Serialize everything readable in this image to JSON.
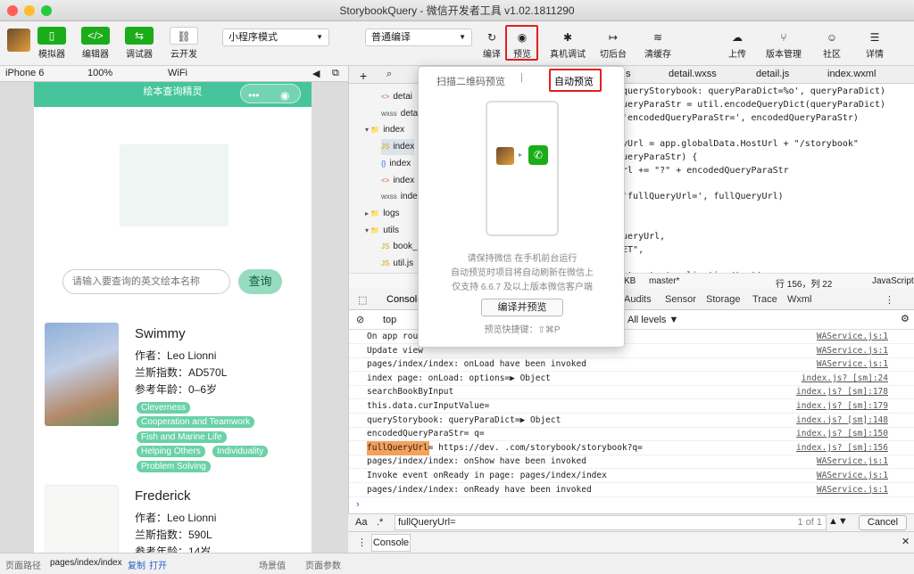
{
  "window": {
    "title": "StorybookQuery - 微信开发者工具 v1.02.1811290"
  },
  "colors": {
    "close": "#fe5f57",
    "minimize": "#febc2e",
    "maximize": "#28c840",
    "accent_green": "#1aad19",
    "nav_green": "#46c59c",
    "highlight_red": "#e0201e",
    "tag_green": "#6ad1a8"
  },
  "toolbar": {
    "simulator": "模拟器",
    "editor": "编辑器",
    "debugger": "调试器",
    "cloud": "云开发",
    "mode_select": "小程序模式",
    "compile_select": "普通编译",
    "compile": "编译",
    "preview": "预览",
    "remote_debug": "真机调试",
    "background": "切后台",
    "clear_cache": "清缓存",
    "upload": "上传",
    "version": "版本管理",
    "community": "社区",
    "details": "详情"
  },
  "device_bar": {
    "device": "iPhone 6",
    "zoom": "100%",
    "network": "WiFi"
  },
  "simulator": {
    "nav_title": "绘本查询精灵",
    "search_placeholder": "请输入要查询的英文绘本名称",
    "search_button": "查询",
    "books": [
      {
        "title": "Swimmy",
        "author": "作者：Leo Lionni",
        "lexile": "兰斯指数：AD570L",
        "age": "参考年龄：0–6岁",
        "tags": [
          "Cleverness",
          "Cooperation and Teamwork",
          "Fish and Marine Life",
          "Helping Others",
          "Individuality",
          "Problem Solving"
        ]
      },
      {
        "title": "Frederick",
        "author": "作者：Leo Lionni",
        "lexile": "兰斯指数：590L",
        "age": "参考年龄：14岁"
      }
    ]
  },
  "sim_status": {
    "path_label": "页面路径",
    "path": "pages/index/index",
    "copy": "复制",
    "open": "打开",
    "scene": "场景值",
    "params": "页面参数"
  },
  "editor": {
    "tabs": [
      "s",
      "detail.wxss",
      "detail.js",
      "index.wxml"
    ],
    "tree": [
      {
        "icon": "<>",
        "name": "detai"
      },
      {
        "icon": "wxss",
        "name": "detai"
      },
      {
        "icon": "▾ 📁",
        "name": "index"
      },
      {
        "icon": "JS",
        "name": "index"
      },
      {
        "icon": "{}",
        "name": "index"
      },
      {
        "icon": "<>",
        "name": "index"
      },
      {
        "icon": "wxss",
        "name": "index"
      },
      {
        "icon": "▸ 📁",
        "name": "logs"
      },
      {
        "icon": "▾ 📁",
        "name": "utils"
      },
      {
        "icon": "JS",
        "name": "book_c"
      },
      {
        "icon": "JS",
        "name": "util.js"
      },
      {
        "icon": "wxss",
        "name": "README"
      }
    ],
    "code": [
      "'queryStorybook: queryParaDict=%o', queryParaDict)",
      "QueryParaStr = util.encodeQueryDict(queryParaDict)",
      "('encodedQueryParaStr=', encodedQueryParaStr)",
      "",
      "ryUrl = app.globalData.HostUrl + \"/storybook\"",
      "QueryParaStr) {",
      "Url += \"?\" + encodedQueryParaStr",
      "",
      "('fullQueryUrl=', fullQueryUrl)",
      "",
      "{",
      "QueryUrl,",
      "GET\",",
      "",
      "t-type': 'application/text'"
    ],
    "status": {
      "size": "KB",
      "branch": "master*",
      "position": "行 156，列 22",
      "lang": "JavaScript"
    }
  },
  "console": {
    "tabs": [
      "Console",
      "Audits",
      "Sensor",
      "Storage",
      "Trace",
      "Wxml"
    ],
    "context": "top",
    "levels": "All levels ▼",
    "logs": [
      {
        "msg": "On app rout",
        "src": "WAService.js:1"
      },
      {
        "msg": "Update view",
        "src": "WAService.js:1"
      },
      {
        "msg": "pages/index/index: onLoad have been invoked",
        "src": "WAService.js:1"
      },
      {
        "msg": "index page: onLoad: options=▶ Object",
        "src": "index.js? [sm]:24"
      },
      {
        "msg": "searchBookByInput",
        "src": "index.js? [sm]:178"
      },
      {
        "msg": "this.data.curInputValue=",
        "src": "index.js? [sm]:179"
      },
      {
        "msg": "queryStorybook: queryParaDict=▶ Object",
        "src": "index.js? [sm]:148"
      },
      {
        "msg": "encodedQueryParaStr= q=",
        "src": "index.js? [sm]:150"
      },
      {
        "msg": "fullQueryUrl= https://dev.          .com/storybook/storybook?q=",
        "src": "index.js? [sm]:156"
      },
      {
        "msg": "pages/index/index: onShow have been invoked",
        "src": "WAService.js:1"
      },
      {
        "msg": "Invoke event onReady in page: pages/index/index",
        "src": "WAService.js:1"
      },
      {
        "msg": "pages/index/index: onReady have been invoked",
        "src": "WAService.js:1"
      }
    ],
    "find_value": "fullQueryUrl=",
    "find_count": "1 of 1",
    "cancel": "Cancel",
    "drawer_tab": "Console"
  },
  "preview_popup": {
    "tab_qr": "扫描二维码预览",
    "tab_auto": "自动预览",
    "line1": "请保持微信        在手机前台运行",
    "line2": "自动预览时项目将自动刷新在微信上",
    "line3": "仅支持 6.6.7 及以上版本微信客户端",
    "button": "编译并预览",
    "shortcut": "预览快捷键：⇧⌘P"
  }
}
